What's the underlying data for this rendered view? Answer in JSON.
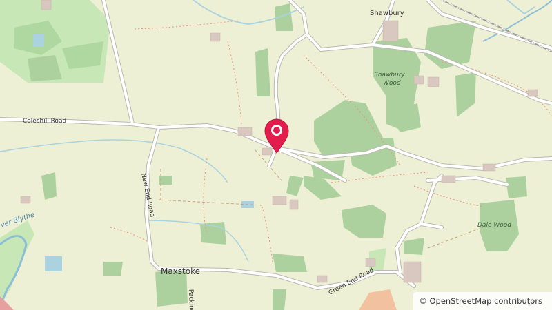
{
  "map": {
    "attribution": "© OpenStreetMap contributors",
    "colors": {
      "background": "#eef0d5",
      "woodland": "#add19e",
      "golf": "#c8e7b7",
      "road": "#ffffff",
      "road_casing": "#b9b9b0",
      "water": "#aad3df",
      "river": "#8cbfd6",
      "track": "#c9a17a",
      "footpath": "#f08c78",
      "building": "#d9c8c0",
      "text": "#333333",
      "marker": "#e21c4c"
    },
    "labels": {
      "coleshill_road": "Coleshill Road",
      "new_end_road": "New End Road",
      "green_end_road": "Green End Road",
      "packington_lane": "Packing",
      "maxstoke": "Maxstoke",
      "shawbury": "Shawbury",
      "shawbury_wood_line1": "Shawbury",
      "shawbury_wood_line2": "Wood",
      "dale_wood": "Dale Wood",
      "river_blythe": "ver Blythe",
      "edge_road": "Gr"
    },
    "marker_icon": "location-pin-icon"
  }
}
